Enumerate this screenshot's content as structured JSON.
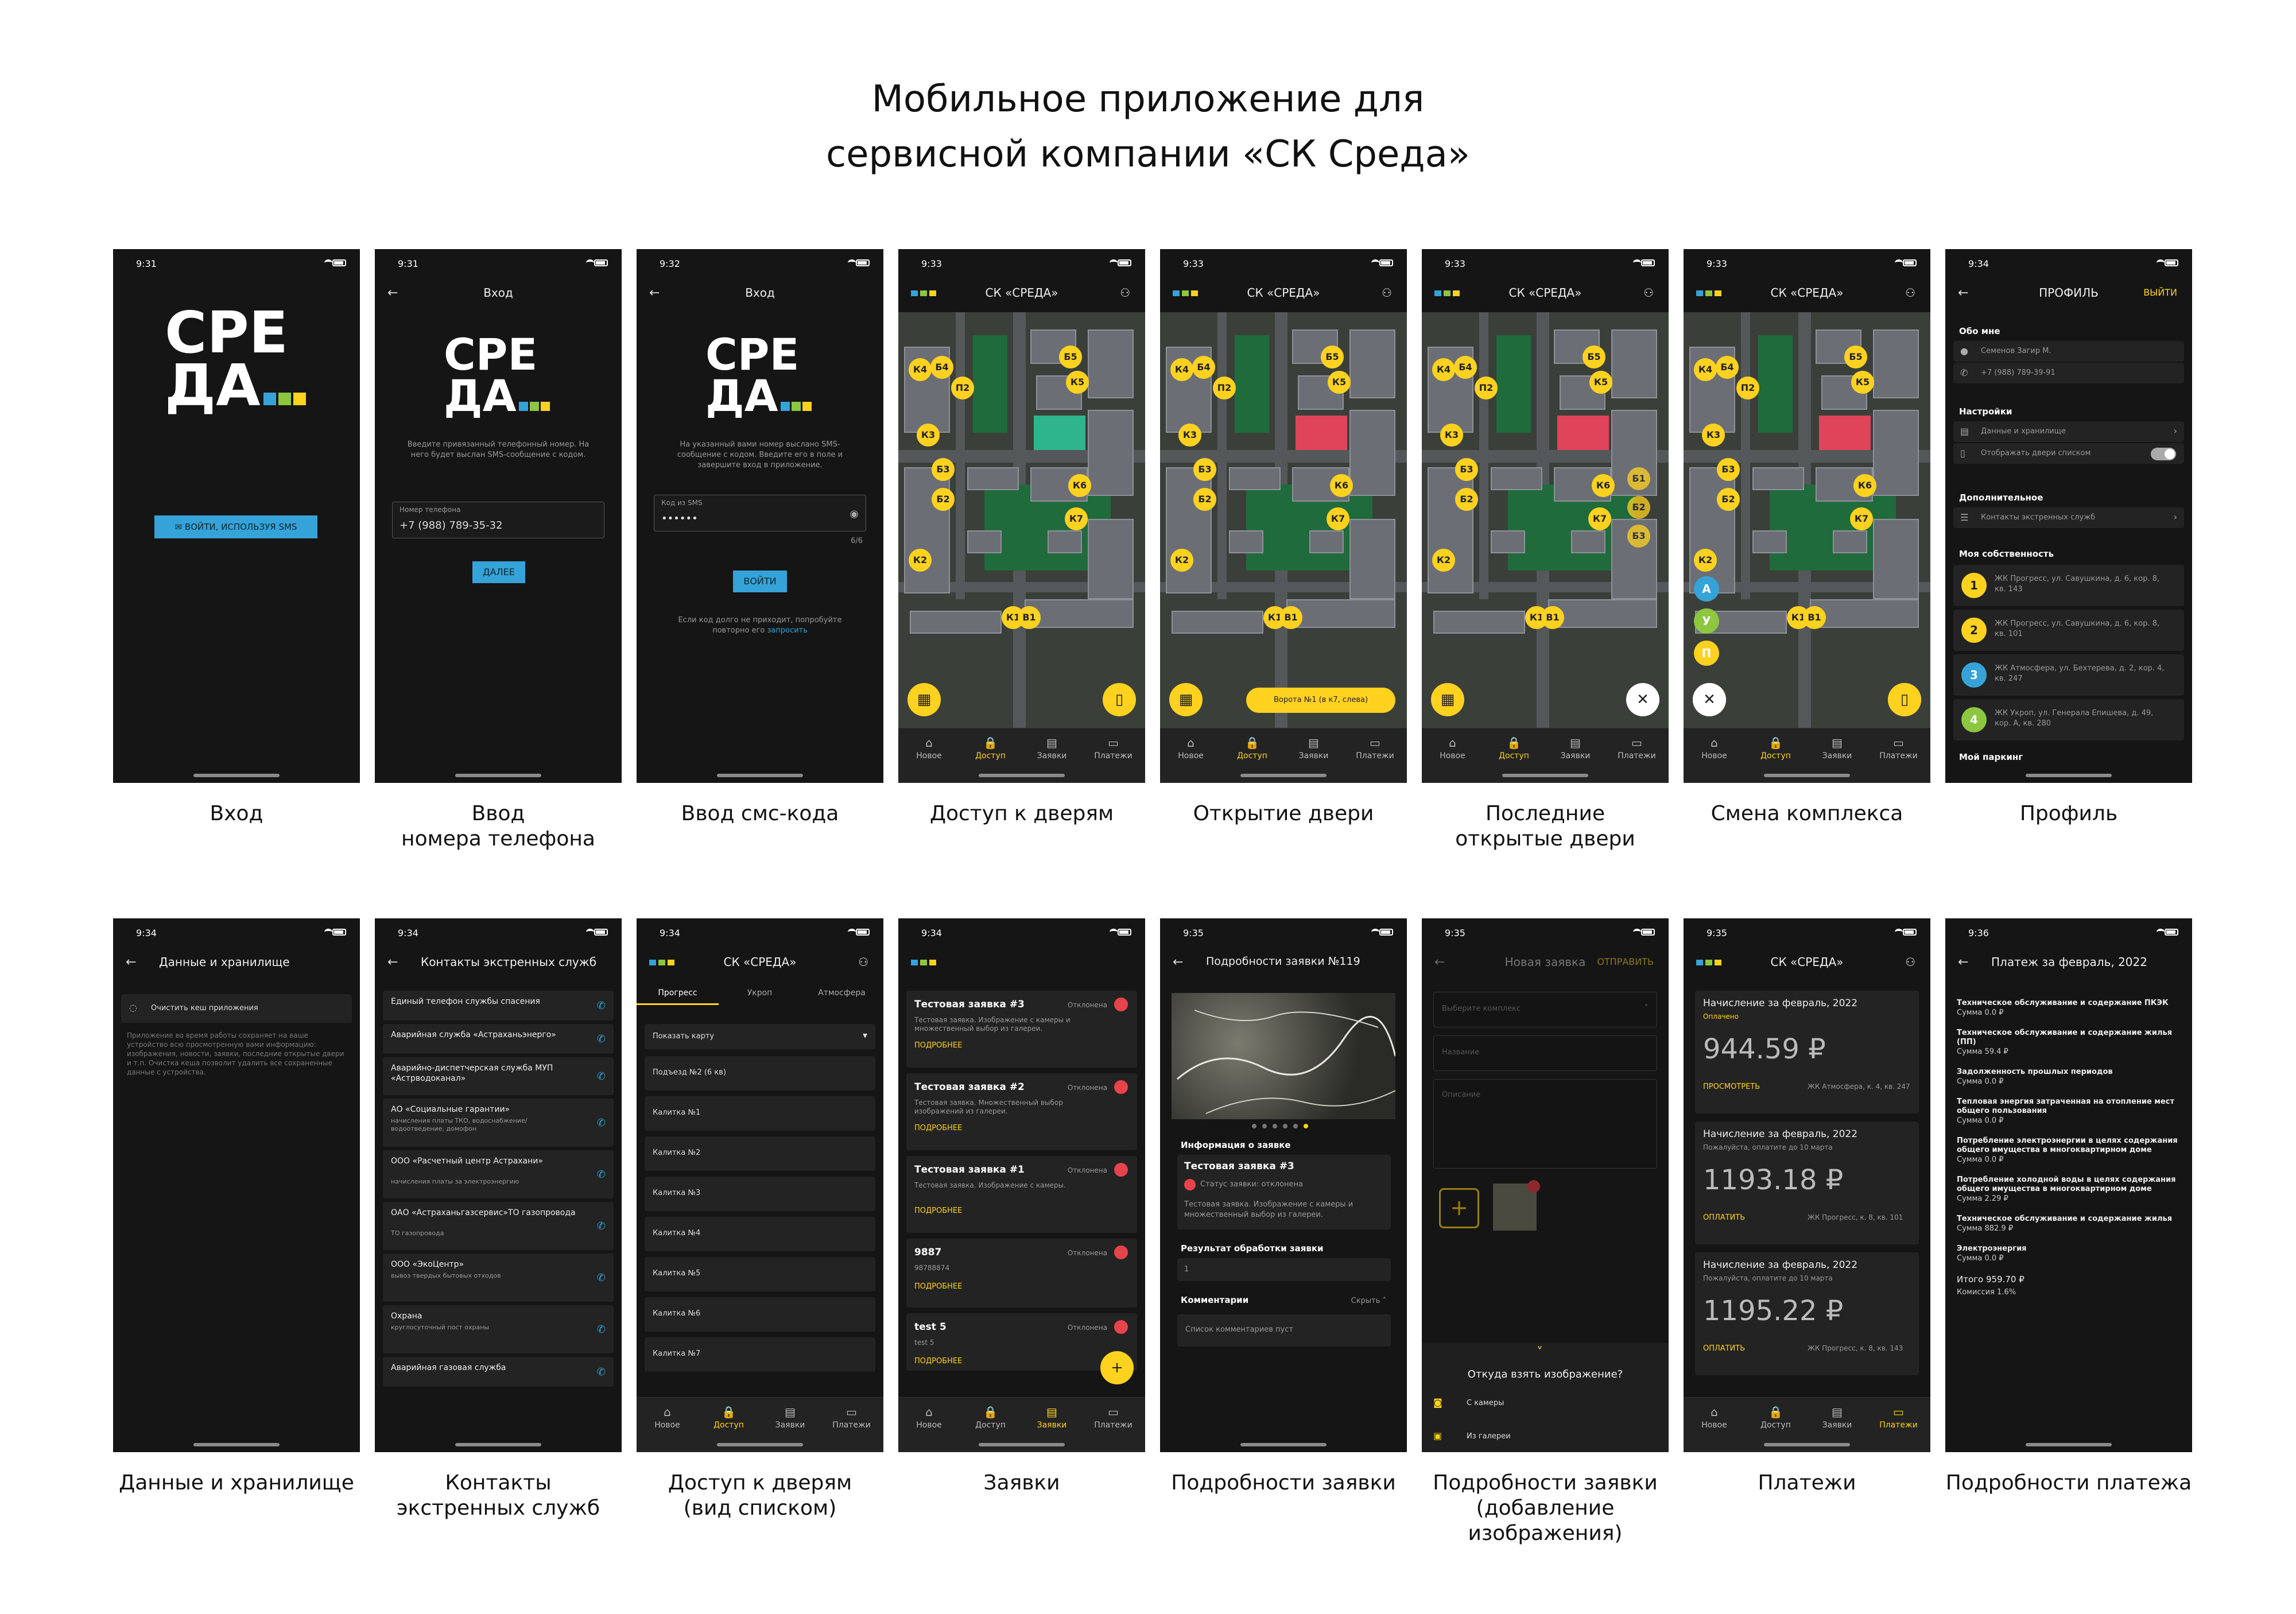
{
  "title": {
    "line1": "Мобильное приложение для",
    "line2": "сервисной компании «СК Среда»"
  },
  "colors": {
    "accent": "#ffd21f",
    "blue": "#35a3d8",
    "green": "#8dc63f",
    "red": "#e8434c",
    "bg": "#151515"
  },
  "captions": [
    "Вход",
    "Ввод",
    "номера телефона",
    "Ввод смс-кода",
    "Доступ к дверям",
    "Открытие двери",
    "Последние",
    "открытые двери",
    "Смена комплекса",
    "Профиль",
    "Данные и хранилище",
    "Контакты",
    "экстренных служб",
    "Доступ к дверям",
    "(вид списком)",
    "Заявки",
    "Подробности заявки",
    "Подробности заявки",
    "(добавление изображения)",
    "Платежи",
    "Подробности платежа"
  ],
  "tabs": [
    "Новое",
    "Доступ",
    "Заявки",
    "Платежи"
  ],
  "logo": {
    "l1": "СРЕ",
    "l2": "ДА"
  },
  "s1": {
    "time": "9:31",
    "btn": "ВОЙТИ, ИСПОЛЬЗУЯ SMS"
  },
  "s2": {
    "time": "9:31",
    "title": "Вход",
    "text": "Введите привязанный телефонный номер. На него будет выслан SMS-сообщение с кодом.",
    "label": "Номер телефона",
    "value": "+7 (988) 789-35-32",
    "btn": "ДАЛЕЕ"
  },
  "s3": {
    "time": "9:32",
    "title": "Вход",
    "text": "На указанный вами номер выслано SMS-сообщение с кодом. Введите его в поле и завершите вход в приложение.",
    "label": "Код из SMS",
    "value": "••••••",
    "counter": "6/6",
    "btn": "ВОЙТИ",
    "hint": "Если код долго не приходит, попробуйте повторно его",
    "link": "запросить"
  },
  "s4": {
    "time": "9:33",
    "title": "СК «СРЕДА»"
  },
  "s5": {
    "time": "9:33",
    "title": "СК «СРЕДА»",
    "gate": "Ворота №1 (в к7, слева)"
  },
  "s6": {
    "time": "9:33",
    "title": "СК «СРЕДА»"
  },
  "s7": {
    "time": "9:33",
    "title": "СК «СРЕДА»",
    "complexes": [
      "А",
      "У",
      "П"
    ]
  },
  "pins": [
    "К4",
    "Б4",
    "П2",
    "Б5",
    "К5",
    "К3",
    "Б3",
    "Б2",
    "К6",
    "К7",
    "К2",
    "К1",
    "В1"
  ],
  "s8": {
    "time": "9:34",
    "title": "ПРОФИЛЬ",
    "exit": "ВЫЙТИ",
    "about": "Обо мне",
    "name": "Семенов Загир М.",
    "phone": "+7 (988) 789-39-91",
    "settings": "Настройки",
    "data": "Данные и хранилище",
    "doors_list": "Отображать двери списком",
    "extra": "Дополнительное",
    "contacts": "Контакты экстренных служб",
    "own": "Моя собственность",
    "props": [
      {
        "n": "1",
        "t": "ЖК Прогресс, ул. Савушкина, д. 6, кор. 8, кв. 143"
      },
      {
        "n": "2",
        "t": "ЖК Прогресс, ул. Савушкина, д. 6, кор. 8, кв. 101"
      },
      {
        "n": "3",
        "t": "ЖК Атмосфера, ул. Бехтерева, д. 2, кор. 4, кв. 247"
      },
      {
        "n": "4",
        "t": "ЖК Укроп, ул. Генерала Епишева, д. 49, кор. А, кв. 280"
      }
    ],
    "parking": "Мой паркинг"
  },
  "s9": {
    "time": "9:34",
    "title": "Данные и хранилище",
    "btn": "Очистить кеш приложения",
    "text": "Приложение во время работы сохраняет на ваше устройство всю просмотренную вами информацию: изображения, новости, заявки, последние открытые двери и т.п. Очистка кеша позволит удалить все сохраненные данные с устройства."
  },
  "s10": {
    "time": "9:34",
    "title": "Контакты экстренных служб",
    "items": [
      {
        "t": "Единый телефон службы спасения",
        "s": ""
      },
      {
        "t": "Аварийная служба «Астраханьэнерго»",
        "s": ""
      },
      {
        "t": "Аварийно-диспетчерская служба МУП «Астрводоканал»",
        "s": ""
      },
      {
        "t": "АО «Социальные гарантии»",
        "s": "начисления платы ТКО, водоснабжение/водоотведение, домофон"
      },
      {
        "t": "ООО «Расчетный центр Астрахани»",
        "s": "начисления платы за электроэнергию"
      },
      {
        "t": "ОАО «Астраханьгазсервис»ТО газопровода",
        "s": "ТО газопровода"
      },
      {
        "t": "ООО «ЭкоЦентр»",
        "s": "вывоз твердых бытовых отходов"
      },
      {
        "t": "Охрана",
        "s": "круглосуточный пост охраны"
      },
      {
        "t": "Аварийная газовая служба",
        "s": ""
      }
    ]
  },
  "s11": {
    "time": "9:34",
    "title": "СК «СРЕДА»",
    "tabs": [
      "Прогресс",
      "Укроп",
      "Атмосфера"
    ],
    "show_map": "Показать карту",
    "items": [
      "Подъезд №2 (6 кв)",
      "Калитка №1",
      "Калитка №2",
      "Калитка №3",
      "Калитка №4",
      "Калитка №5",
      "Калитка №6",
      "Калитка №7"
    ]
  },
  "s12": {
    "time": "9:34",
    "more": "ПОДРОБНЕЕ",
    "status": "Отклонена",
    "items": [
      {
        "t": "Тестовая заявка #3",
        "d": "Тестовая заявка. Изображение с камеры и множественный выбор из галереи."
      },
      {
        "t": "Тестовая заявка #2",
        "d": "Тестовая заявка. Множественный выбор изображений из галереи."
      },
      {
        "t": "Тестовая заявка #1",
        "d": "Тестовая заявка. Изображение с камеры."
      },
      {
        "t": "9887",
        "d": "98788874"
      },
      {
        "t": "test 5",
        "d": "test 5"
      }
    ]
  },
  "s13": {
    "time": "9:35",
    "title": "Подробности заявки №119",
    "info": "Информация о заявке",
    "name": "Тестовая заявка #3",
    "status": "Статус заявки: отклонена",
    "desc": "Тестовая заявка. Изображение с камеры и множественный выбор из галереи.",
    "result": "Результат обработки заявки",
    "result_val": "1",
    "comments": "Комментарии",
    "hide": "Скрыть",
    "empty": "Список комментариев пуст"
  },
  "s14": {
    "time": "9:35",
    "title": "Новая заявка",
    "send": "ОТПРАВИТЬ",
    "select": "Выберите комплекс",
    "name": "Название",
    "desc": "Описание",
    "q": "Откуда взять изображение?",
    "cam": "С камеры",
    "gal": "Из галереи"
  },
  "s15": {
    "time": "9:35",
    "title": "СК «СРЕДА»",
    "items": [
      {
        "h": "Начисление за февраль, 2022",
        "s": "Оплачено",
        "a": "944.59 ₽",
        "b": "ПРОСМОТРЕТЬ",
        "addr": "ЖК Атмосфера, к. 4, кв. 247"
      },
      {
        "h": "Начисление за февраль, 2022",
        "s": "Пожалуйста, оплатите до 10 марта",
        "a": "1193.18 ₽",
        "b": "ОПЛАТИТЬ",
        "addr": "ЖК Прогресс, к. 8, кв. 101"
      },
      {
        "h": "Начисление за февраль, 2022",
        "s": "Пожалуйста, оплатите до 10 марта",
        "a": "1195.22 ₽",
        "b": "ОПЛАТИТЬ",
        "addr": "ЖК Прогресс, к. 8, кв. 143"
      }
    ]
  },
  "s16": {
    "time": "9:36",
    "title": "Платеж за февраль, 2022",
    "items": [
      {
        "t": "Техническое обслуживание и содержание ПКЭК",
        "v": "Сумма 0.0 ₽"
      },
      {
        "t": "Техническое обслуживание и содержание жилья (ПП)",
        "v": "Сумма 59.4 ₽"
      },
      {
        "t": "Задолженность прошлых периодов",
        "v": "Сумма 0.0 ₽"
      },
      {
        "t": "Тепловая энергия затраченная на отопление мест общего пользования",
        "v": "Сумма 0.0 ₽"
      },
      {
        "t": "Потребление электроэнергии в целях содержания общего имущества в многоквартирном доме",
        "v": "Сумма 0.0 ₽"
      },
      {
        "t": "Потребление холодной воды в целях содержания общего имущества в многоквартирном доме",
        "v": "Сумма 2.29 ₽"
      },
      {
        "t": "Техническое обслуживание и содержание жилья",
        "v": "Сумма 882.9 ₽"
      },
      {
        "t": "Электроэнергия",
        "v": "Сумма 0.0 ₽"
      }
    ],
    "total": "Итого 959.70 ₽",
    "fee": "Комиссия 1.6%"
  }
}
